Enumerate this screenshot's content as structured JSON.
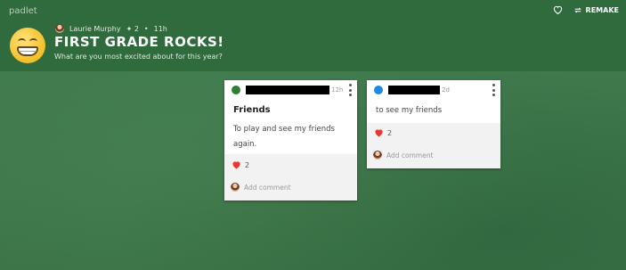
{
  "app": {
    "brand": "padlet"
  },
  "actions": {
    "remake_label": "REMAKE",
    "like_icon": "heart-outline-icon",
    "remake_icon": "repeat-icon"
  },
  "board": {
    "author": "Laurie Murphy",
    "plus_count": "2",
    "age": "11h",
    "title": "FIRST GRADE ROCKS!",
    "description": "What are you most excited about for this year?",
    "emoji_icon": "grinning-face-icon"
  },
  "posts": [
    {
      "time": "12h",
      "title": "Friends",
      "body": "To play and see my friends again.",
      "likes": "2",
      "comment_placeholder": "Add comment",
      "avatar_color": "#2e7d32"
    },
    {
      "time": "2d",
      "title": "",
      "body": "to see my friends",
      "likes": "2",
      "comment_placeholder": "Add comment",
      "avatar_color": "#1e88e5"
    }
  ],
  "colors": {
    "header_bg": "#2f6b3c",
    "board_bg": "#3f7a4c",
    "heart": "#e53935"
  }
}
